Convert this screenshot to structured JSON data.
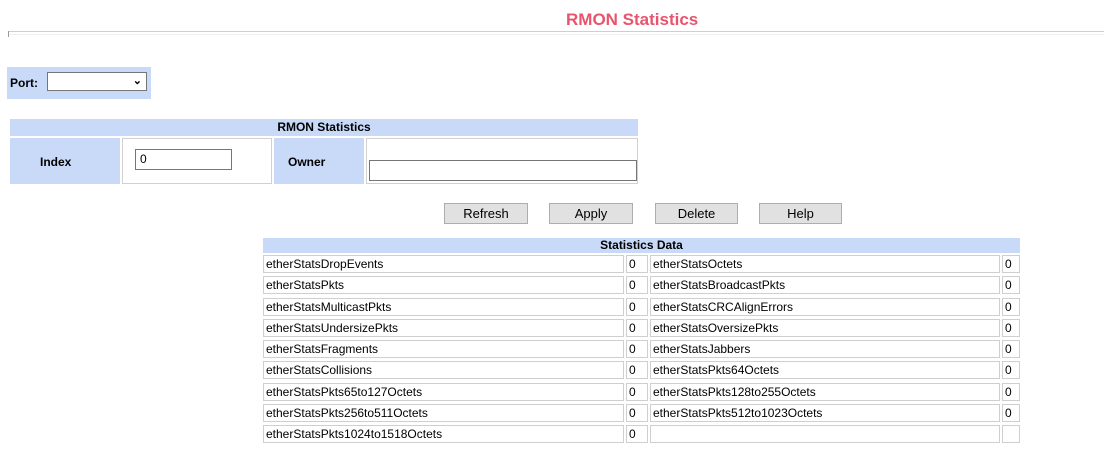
{
  "page": {
    "title": "RMON Statistics"
  },
  "port": {
    "label": "Port:",
    "selected": ""
  },
  "rmon": {
    "header": "RMON Statistics",
    "index_label": "Index",
    "index_value": "0",
    "owner_label": "Owner",
    "owner_value": ""
  },
  "buttons": {
    "refresh": "Refresh",
    "apply": "Apply",
    "delete": "Delete",
    "help": "Help"
  },
  "stats": {
    "header": "Statistics Data",
    "rows": [
      {
        "name1": "etherStatsDropEvents",
        "value1": "0",
        "name2": "etherStatsOctets",
        "value2": "0"
      },
      {
        "name1": "etherStatsPkts",
        "value1": "0",
        "name2": "etherStatsBroadcastPkts",
        "value2": "0"
      },
      {
        "name1": "etherStatsMulticastPkts",
        "value1": "0",
        "name2": "etherStatsCRCAlignErrors",
        "value2": "0"
      },
      {
        "name1": "etherStatsUndersizePkts",
        "value1": "0",
        "name2": "etherStatsOversizePkts",
        "value2": "0"
      },
      {
        "name1": "etherStatsFragments",
        "value1": "0",
        "name2": "etherStatsJabbers",
        "value2": "0"
      },
      {
        "name1": "etherStatsCollisions",
        "value1": "0",
        "name2": "etherStatsPkts64Octets",
        "value2": "0"
      },
      {
        "name1": "etherStatsPkts65to127Octets",
        "value1": "0",
        "name2": "etherStatsPkts128to255Octets",
        "value2": "0"
      },
      {
        "name1": "etherStatsPkts256to511Octets",
        "value1": "0",
        "name2": "etherStatsPkts512to1023Octets",
        "value2": "0"
      },
      {
        "name1": "etherStatsPkts1024to1518Octets",
        "value1": "0",
        "name2": "",
        "value2": ""
      }
    ]
  },
  "colors": {
    "title": "#e8546d",
    "header_bg": "#c9daf8"
  },
  "icons": {
    "port_dropdown": "chevron-down-icon"
  }
}
